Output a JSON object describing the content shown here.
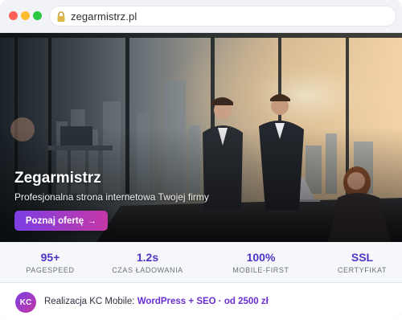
{
  "browser": {
    "url": "zegarmistrz.pl"
  },
  "hero": {
    "title": "Zegarmistrz",
    "subtitle": "Profesjonalna strona internetowa Twojej firmy",
    "cta_label": "Poznaj ofertę",
    "cta_arrow": "→"
  },
  "stats": [
    {
      "value": "95+",
      "label": "PAGESPEED"
    },
    {
      "value": "1.2s",
      "label": "CZAS ŁADOWANIA"
    },
    {
      "value": "100%",
      "label": "MOBILE-FIRST"
    },
    {
      "value": "SSL",
      "label": "CERTYFIKAT"
    }
  ],
  "footer": {
    "avatar_initials": "KC",
    "credit_prefix": "Realizacja KC Mobile:",
    "credit_link": "WordPress + SEO · od 2500 zł"
  },
  "colors": {
    "accent_purple": "#7b3fe4",
    "accent_pink": "#c438a6",
    "stat_value": "#4a35c6"
  }
}
